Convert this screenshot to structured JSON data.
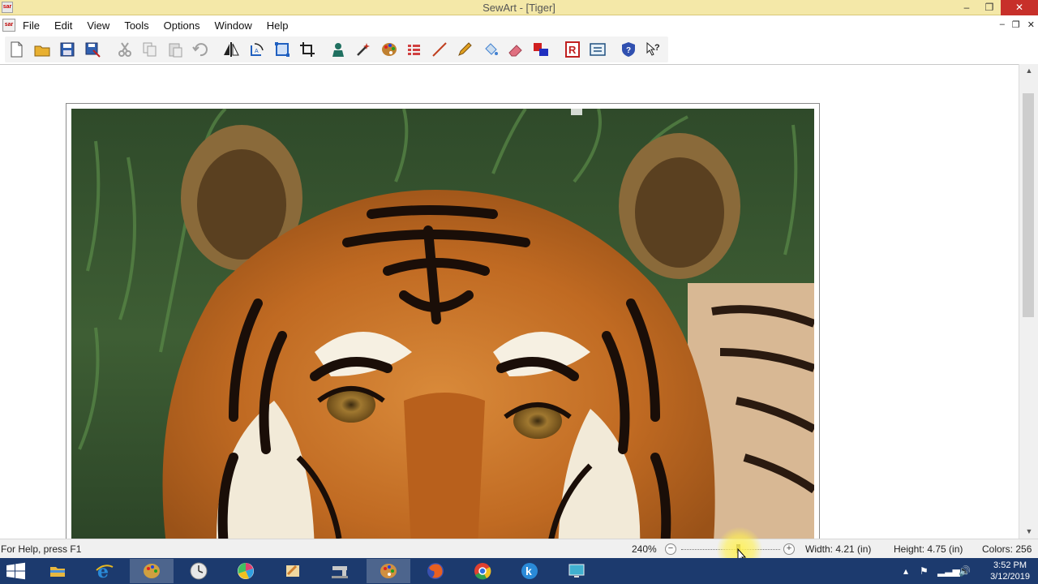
{
  "window": {
    "title": "SewArt - [Tiger]",
    "app_icon_text": "sar",
    "minimize": "–",
    "restore": "❐",
    "close": "✕"
  },
  "menu": {
    "items": [
      "File",
      "Edit",
      "View",
      "Tools",
      "Options",
      "Window",
      "Help"
    ],
    "doc_minimize": "–",
    "doc_restore": "❐",
    "doc_close": "✕"
  },
  "toolbar": {
    "tools": [
      {
        "name": "new-icon",
        "color": "#ffffff"
      },
      {
        "name": "open-folder-icon",
        "color": "#e8b030"
      },
      {
        "name": "save-icon",
        "color": "#3060b0"
      },
      {
        "name": "save-as-icon",
        "color": "#3060b0"
      },
      {
        "name": "cut-icon",
        "color": "#a0a0a0"
      },
      {
        "name": "copy-icon",
        "color": "#a0a0a0"
      },
      {
        "name": "paste-icon",
        "color": "#a0a0a0"
      },
      {
        "name": "undo-icon",
        "color": "#a0a0a0"
      },
      {
        "name": "flip-icon",
        "color": "#222222"
      },
      {
        "name": "rotate-icon",
        "color": "#2060c0"
      },
      {
        "name": "resize-icon",
        "color": "#2060c0"
      },
      {
        "name": "crop-icon",
        "color": "#222222"
      },
      {
        "name": "merge-icon",
        "color": "#207060"
      },
      {
        "name": "magic-wand-icon",
        "color": "#c03020"
      },
      {
        "name": "palette-icon",
        "color": "#c08030"
      },
      {
        "name": "color-list-icon",
        "color": "#d04040"
      },
      {
        "name": "line-icon",
        "color": "#c04020"
      },
      {
        "name": "pencil-icon",
        "color": "#e0a020"
      },
      {
        "name": "fill-icon",
        "color": "#4080d0"
      },
      {
        "name": "eraser-icon",
        "color": "#e07080"
      },
      {
        "name": "shapes-icon",
        "color": "#d02020"
      },
      {
        "name": "replace-icon",
        "color": "#c02020"
      },
      {
        "name": "convert-icon",
        "color": "#205080"
      },
      {
        "name": "help-shield-icon",
        "color": "#3050b0"
      },
      {
        "name": "context-help-icon",
        "color": "#222222"
      }
    ]
  },
  "status": {
    "help_text": "For Help, press F1",
    "zoom": "240%",
    "zoom_out": "−",
    "zoom_in": "+",
    "zoom_level": 0.57,
    "width": "Width: 4.21 (in)",
    "height": "Height: 4.75 (in)",
    "colors": "Colors: 256"
  },
  "taskbar": {
    "apps": [
      {
        "name": "file-explorer-icon",
        "color": "#e8b840",
        "active": false
      },
      {
        "name": "internet-explorer-icon",
        "color": "#2a8ad8",
        "active": false
      },
      {
        "name": "sewart-palette-icon",
        "color": "#d0a040",
        "active": true
      },
      {
        "name": "clock-app-icon",
        "color": "#e8e8e8",
        "active": false
      },
      {
        "name": "color-wheel-icon",
        "color": "#e04070",
        "active": false
      },
      {
        "name": "paint-app-icon",
        "color": "#d08030",
        "active": false
      },
      {
        "name": "sewing-machine-icon",
        "color": "#c8c8c8",
        "active": false
      },
      {
        "name": "sewart-app-icon",
        "color": "#d09040",
        "active": true
      },
      {
        "name": "firefox-icon",
        "color": "#e86020",
        "active": false
      },
      {
        "name": "chrome-icon",
        "color": "#30a050",
        "active": false
      },
      {
        "name": "k-app-icon",
        "color": "#2a8ad8",
        "active": false
      },
      {
        "name": "monitor-app-icon",
        "color": "#40b0d0",
        "active": false
      }
    ],
    "time": "3:52 PM",
    "date": "3/12/2019"
  }
}
